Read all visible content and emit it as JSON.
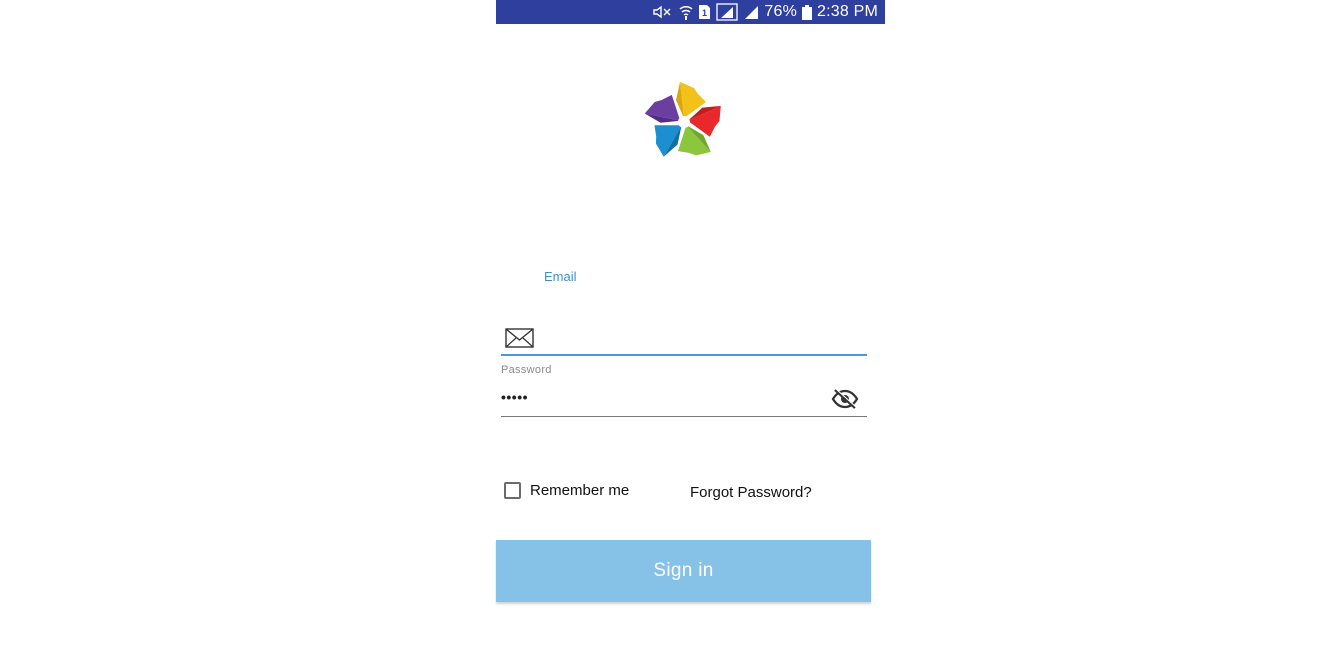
{
  "status_bar": {
    "battery": "76%",
    "time": "2:38 PM",
    "sim": "1",
    "icons": [
      "mute-icon",
      "wifi-icon",
      "sim-icon",
      "signal-icon",
      "signal-icon",
      "battery-icon"
    ]
  },
  "logo": {
    "icon": "pinwheel-logo",
    "colors": [
      "#f2c21b",
      "#e8282b",
      "#8cc63e",
      "#1b8fcf",
      "#6a3fa0"
    ]
  },
  "email": {
    "label": "Email",
    "icon": "mail-icon",
    "value": ""
  },
  "password": {
    "label": "Password",
    "value": "•••••",
    "icon": "eye-off-icon"
  },
  "remember": {
    "label": "Remember me",
    "checked": false
  },
  "forgot": {
    "label": "Forgot Password?"
  },
  "signin": {
    "label": "Sign in"
  },
  "colors": {
    "status_bar": "#2f3f9e",
    "accent": "#4a9ad8",
    "button": "#86c2e8"
  }
}
